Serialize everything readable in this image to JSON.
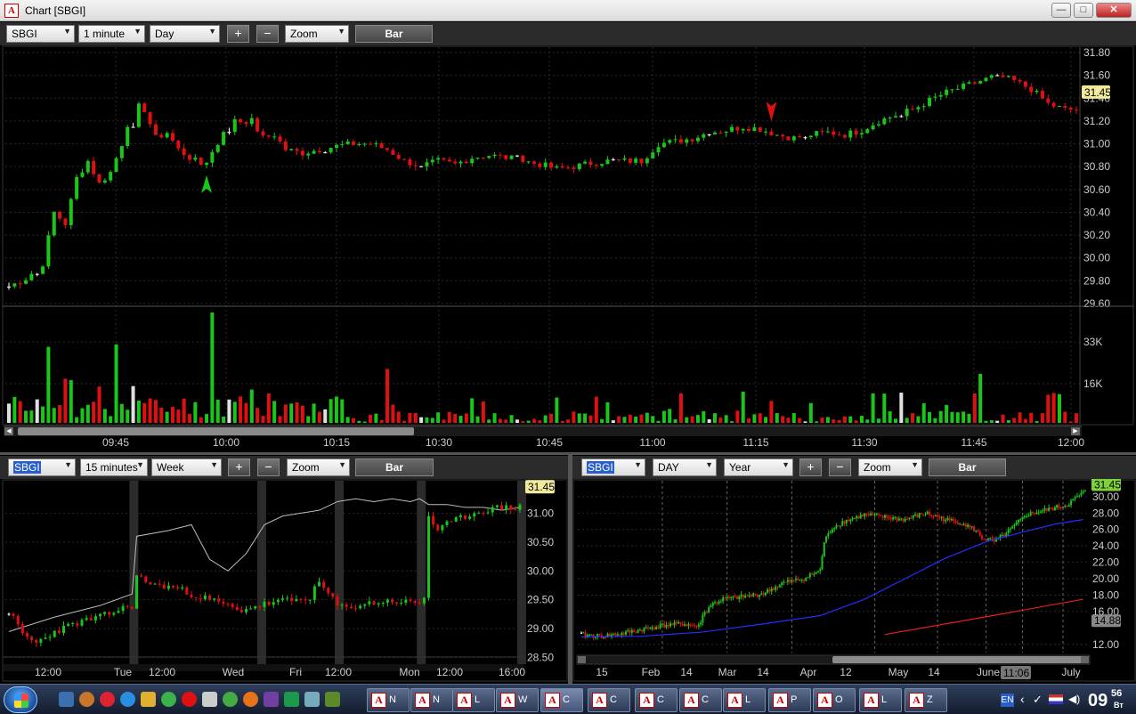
{
  "window": {
    "title": "Chart [SBGI]",
    "logo": "A",
    "buttons": {
      "minimize": "—",
      "maximize": "□",
      "close": "✕"
    }
  },
  "top": {
    "toolbar": {
      "symbol": "SBGI",
      "interval": "1 minute",
      "range": "Day",
      "plus": "+",
      "minus": "−",
      "zoom": "Zoom",
      "bar": "Bar"
    },
    "price_badge": "31.45",
    "arrows": {
      "up_color": "#19c619",
      "down_color": "#e01010"
    }
  },
  "bottom_left": {
    "toolbar": {
      "symbol": "SBGI",
      "interval": "15 minutes",
      "range": "Week",
      "plus": "+",
      "minus": "−",
      "zoom": "Zoom",
      "bar": "Bar"
    },
    "price_badge": "31.45"
  },
  "bottom_right": {
    "toolbar": {
      "symbol": "SBGI",
      "interval": "DAY",
      "range": "Year",
      "plus": "+",
      "minus": "−",
      "zoom": "Zoom",
      "bar": "Bar"
    },
    "price_badge": "31.45",
    "ma_badge": "14.88",
    "cursor_label": "11:06"
  },
  "chart_data": [
    {
      "type": "candlestick",
      "name": "SBGI 1 minute intraday",
      "y_ticks": [
        "31.80",
        "31.60",
        "31.40",
        "31.20",
        "31.00",
        "30.80",
        "30.60",
        "30.40",
        "30.20",
        "30.00",
        "29.80",
        "29.60"
      ],
      "y_values": [
        31.8,
        31.6,
        31.4,
        31.2,
        31.0,
        30.8,
        30.6,
        30.4,
        30.2,
        30.0,
        29.8,
        29.6
      ],
      "ylim": [
        29.6,
        31.8
      ],
      "x_ticks": [
        "09:45",
        "10:00",
        "10:15",
        "10:30",
        "10:45",
        "11:00",
        "11:15",
        "11:30",
        "11:45",
        "12:00"
      ],
      "close_path": [
        [
          0,
          29.75
        ],
        [
          3,
          29.82
        ],
        [
          6,
          29.95
        ],
        [
          8,
          30.4
        ],
        [
          10,
          30.3
        ],
        [
          12,
          30.7
        ],
        [
          14,
          30.85
        ],
        [
          16,
          30.65
        ],
        [
          18,
          30.75
        ],
        [
          20,
          31.0
        ],
        [
          22,
          31.35
        ],
        [
          24,
          31.3
        ],
        [
          26,
          31.05
        ],
        [
          28,
          31.1
        ],
        [
          30,
          30.95
        ],
        [
          32,
          30.88
        ],
        [
          34,
          30.82
        ],
        [
          35,
          30.85
        ],
        [
          37,
          31.0
        ],
        [
          39,
          31.25
        ],
        [
          41,
          31.2
        ],
        [
          43,
          31.2
        ],
        [
          45,
          31.05
        ],
        [
          47,
          31.08
        ],
        [
          49,
          30.95
        ],
        [
          52,
          30.92
        ],
        [
          55,
          30.95
        ],
        [
          58,
          30.98
        ],
        [
          61,
          31.0
        ],
        [
          64,
          31.0
        ],
        [
          67,
          30.95
        ],
        [
          70,
          30.85
        ],
        [
          73,
          30.8
        ],
        [
          76,
          30.85
        ],
        [
          79,
          30.82
        ],
        [
          82,
          30.88
        ],
        [
          85,
          30.9
        ],
        [
          88,
          30.88
        ],
        [
          91,
          30.85
        ],
        [
          94,
          30.82
        ],
        [
          97,
          30.78
        ],
        [
          100,
          30.8
        ],
        [
          103,
          30.83
        ],
        [
          106,
          30.85
        ],
        [
          109,
          30.85
        ],
        [
          112,
          30.85
        ],
        [
          115,
          31.0
        ],
        [
          118,
          31.02
        ],
        [
          121,
          31.05
        ],
        [
          124,
          31.1
        ],
        [
          127,
          31.12
        ],
        [
          130,
          31.15
        ],
        [
          133,
          31.13
        ],
        [
          136,
          31.08
        ],
        [
          139,
          31.05
        ],
        [
          142,
          31.08
        ],
        [
          145,
          31.1
        ],
        [
          148,
          31.08
        ],
        [
          151,
          31.12
        ],
        [
          154,
          31.2
        ],
        [
          157,
          31.25
        ],
        [
          160,
          31.3
        ],
        [
          163,
          31.38
        ],
        [
          166,
          31.45
        ],
        [
          169,
          31.5
        ],
        [
          172,
          31.55
        ],
        [
          175,
          31.6
        ],
        [
          178,
          31.55
        ],
        [
          181,
          31.48
        ],
        [
          184,
          31.35
        ],
        [
          187,
          31.3
        ],
        [
          190,
          31.3
        ]
      ],
      "candle_count": 190,
      "signals": [
        {
          "type": "buy",
          "index": 35
        },
        {
          "type": "sell",
          "index": 135
        }
      ],
      "volume_ticks": [
        "33K",
        "16K"
      ],
      "volume_tick_values": [
        33000,
        16000
      ],
      "volume_max": 45000,
      "volume_spikes": [
        [
          7,
          31000
        ],
        [
          10,
          18000
        ],
        [
          19,
          32000
        ],
        [
          22,
          15000
        ],
        [
          36,
          45000
        ],
        [
          46,
          12000
        ],
        [
          67,
          22000
        ],
        [
          119,
          12000
        ],
        [
          171,
          12000
        ],
        [
          172,
          20000
        ]
      ],
      "price_last": 31.45,
      "colors": {
        "up": "#19c619",
        "down": "#e01010",
        "neutral": "#ffffff",
        "grid": "#333333"
      }
    },
    {
      "type": "candlestick",
      "name": "SBGI 15 minute week",
      "y_ticks": [
        "31.00",
        "30.50",
        "30.00",
        "29.50",
        "29.00",
        "28.50"
      ],
      "y_values": [
        31.0,
        30.5,
        30.0,
        29.5,
        29.0,
        28.5
      ],
      "ylim": [
        28.4,
        31.5
      ],
      "x_ticks": [
        "12:00",
        "Tue",
        "12:00",
        "Wed",
        "Fri",
        "12:00",
        "Mon",
        "12:00",
        "16:00"
      ],
      "close_path": [
        [
          0,
          29.3
        ],
        [
          3,
          28.9
        ],
        [
          6,
          28.75
        ],
        [
          10,
          28.95
        ],
        [
          15,
          29.1
        ],
        [
          20,
          29.2
        ],
        [
          25,
          29.35
        ],
        [
          27,
          29.4
        ],
        [
          28,
          29.9
        ],
        [
          32,
          29.75
        ],
        [
          36,
          29.72
        ],
        [
          40,
          29.6
        ],
        [
          44,
          29.5
        ],
        [
          48,
          29.4
        ],
        [
          50,
          29.3
        ],
        [
          52,
          29.35
        ],
        [
          56,
          29.42
        ],
        [
          60,
          29.48
        ],
        [
          64,
          29.5
        ],
        [
          66,
          29.55
        ],
        [
          68,
          29.8
        ],
        [
          70,
          29.6
        ],
        [
          72,
          29.4
        ],
        [
          74,
          29.35
        ],
        [
          76,
          29.4
        ],
        [
          80,
          29.45
        ],
        [
          84,
          29.48
        ],
        [
          88,
          29.45
        ],
        [
          90,
          29.45
        ],
        [
          91,
          29.55
        ],
        [
          92,
          30.95
        ],
        [
          94,
          30.7
        ],
        [
          96,
          30.8
        ],
        [
          100,
          30.95
        ],
        [
          104,
          31.05
        ],
        [
          108,
          31.1
        ],
        [
          112,
          31.1
        ]
      ],
      "comparison_line": [
        [
          0,
          28.95
        ],
        [
          10,
          29.2
        ],
        [
          20,
          29.4
        ],
        [
          27,
          29.6
        ],
        [
          28,
          30.6
        ],
        [
          35,
          30.7
        ],
        [
          40,
          30.8
        ],
        [
          44,
          30.2
        ],
        [
          48,
          30.0
        ],
        [
          52,
          30.3
        ],
        [
          56,
          30.8
        ],
        [
          60,
          30.95
        ],
        [
          64,
          31.0
        ],
        [
          68,
          31.05
        ],
        [
          72,
          31.2
        ],
        [
          76,
          31.25
        ],
        [
          80,
          31.2
        ],
        [
          84,
          31.25
        ],
        [
          88,
          31.2
        ],
        [
          90,
          31.25
        ],
        [
          92,
          31.15
        ],
        [
          96,
          31.15
        ],
        [
          100,
          31.1
        ],
        [
          104,
          31.1
        ],
        [
          108,
          31.05
        ],
        [
          112,
          31.1
        ]
      ],
      "session_dividers": [
        27,
        55,
        72,
        90,
        112
      ],
      "price_last": 31.45
    },
    {
      "type": "candlestick",
      "name": "SBGI daily year",
      "y_ticks": [
        "30.00",
        "28.00",
        "26.00",
        "24.00",
        "22.00",
        "20.00",
        "18.00",
        "16.00",
        "12.00"
      ],
      "y_values": [
        30,
        28,
        26,
        24,
        22,
        20,
        18,
        16,
        12
      ],
      "ylim": [
        11.0,
        31.5
      ],
      "x_ticks": [
        "15",
        "Feb",
        "14",
        "Mar",
        "14",
        "Apr",
        "12",
        "May",
        "14",
        "June",
        "July"
      ],
      "close_path": [
        [
          0,
          13.2
        ],
        [
          10,
          13.0
        ],
        [
          20,
          13.3
        ],
        [
          30,
          13.8
        ],
        [
          40,
          14.3
        ],
        [
          50,
          14.5
        ],
        [
          58,
          14.2
        ],
        [
          60,
          15.5
        ],
        [
          64,
          16.8
        ],
        [
          70,
          17.5
        ],
        [
          80,
          17.8
        ],
        [
          90,
          18.2
        ],
        [
          100,
          19.5
        ],
        [
          110,
          20.0
        ],
        [
          118,
          21.0
        ],
        [
          120,
          24.5
        ],
        [
          124,
          26.2
        ],
        [
          130,
          27.0
        ],
        [
          140,
          27.8
        ],
        [
          150,
          27.5
        ],
        [
          160,
          27.2
        ],
        [
          170,
          28.0
        ],
        [
          180,
          27.2
        ],
        [
          188,
          26.8
        ],
        [
          194,
          26.0
        ],
        [
          198,
          25.0
        ],
        [
          204,
          24.5
        ],
        [
          210,
          25.5
        ],
        [
          220,
          27.8
        ],
        [
          232,
          28.5
        ],
        [
          240,
          29.0
        ],
        [
          248,
          30.5
        ]
      ],
      "ma_blue": [
        [
          0,
          12.9
        ],
        [
          30,
          13.0
        ],
        [
          60,
          13.5
        ],
        [
          90,
          14.5
        ],
        [
          118,
          15.5
        ],
        [
          140,
          17.5
        ],
        [
          160,
          20.0
        ],
        [
          180,
          22.5
        ],
        [
          200,
          24.5
        ],
        [
          220,
          25.8
        ],
        [
          235,
          26.7
        ],
        [
          248,
          27.2
        ]
      ],
      "ma_red": [
        [
          150,
          13.2
        ],
        [
          180,
          14.5
        ],
        [
          210,
          15.8
        ],
        [
          248,
          17.5
        ]
      ],
      "date_dividers": [
        40,
        72,
        104,
        145,
        176,
        200,
        218,
        238
      ],
      "price_last": 31.45,
      "ma_last": 14.88
    }
  ],
  "taskbar": {
    "tasks": [
      {
        "icon": "A",
        "label": "N"
      },
      {
        "icon": "A",
        "label": "N"
      },
      {
        "icon": "A",
        "label": "L"
      },
      {
        "icon": "A",
        "label": "W"
      },
      {
        "icon": "A",
        "label": "C"
      },
      {
        "icon": "A",
        "label": "C"
      },
      {
        "icon": "A",
        "label": "C"
      },
      {
        "icon": "A",
        "label": "C"
      },
      {
        "icon": "A",
        "label": "L"
      },
      {
        "icon": "A",
        "label": "P"
      },
      {
        "icon": "A",
        "label": "O"
      },
      {
        "icon": "A",
        "label": "L"
      },
      {
        "icon": "A",
        "label": "Z"
      }
    ],
    "lang": "EN",
    "clock_hm": "09",
    "clock_min": "56",
    "clock_sub": "Вт"
  }
}
